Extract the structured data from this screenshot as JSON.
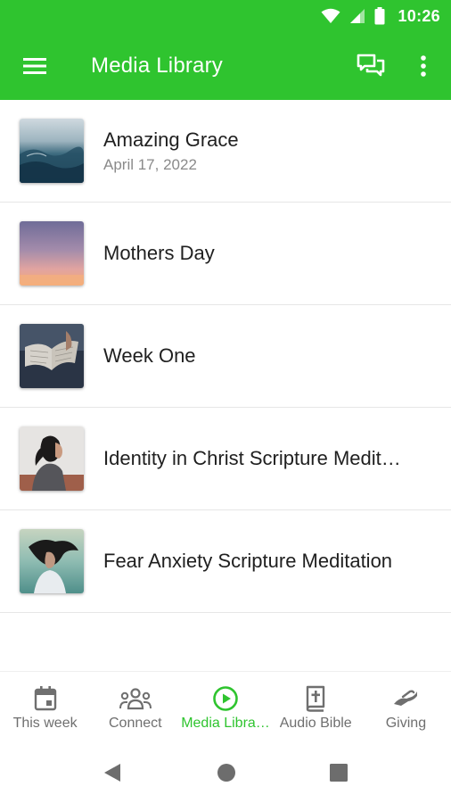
{
  "status_bar": {
    "time": "10:26",
    "icons": [
      "wifi-icon",
      "signal-icon",
      "battery-icon"
    ]
  },
  "app_bar": {
    "title": "Media Library",
    "icons": [
      "menu-icon",
      "chat-icon",
      "more-vert-icon"
    ],
    "color": "#2fc42f"
  },
  "media_list": {
    "items": [
      {
        "title": "Amazing Grace",
        "date": "April 17, 2022",
        "thumbnail": "ocean-waves"
      },
      {
        "title": "Mothers Day",
        "date": "",
        "thumbnail": "sunset-sky"
      },
      {
        "title": "Week One",
        "date": "",
        "thumbnail": "open-book"
      },
      {
        "title": "Identity in Christ Scripture Medit…",
        "date": "",
        "thumbnail": "woman-profile"
      },
      {
        "title": "Fear Anxiety Scripture Meditation",
        "date": "",
        "thumbnail": "woman-hair-wind"
      }
    ]
  },
  "bottom_nav": {
    "tabs": [
      {
        "label": "This week",
        "icon": "calendar-icon",
        "active": false
      },
      {
        "label": "Connect",
        "icon": "group-icon",
        "active": false
      },
      {
        "label": "Media Libra…",
        "icon": "play-circle-icon",
        "active": true
      },
      {
        "label": "Audio Bible",
        "icon": "bible-icon",
        "active": false
      },
      {
        "label": "Giving",
        "icon": "giving-hand-icon",
        "active": false
      }
    ],
    "active_color": "#2fc42f",
    "inactive_color": "#6f6f6f"
  },
  "system_nav": {
    "icons": [
      "back-icon",
      "home-icon",
      "recents-icon"
    ]
  }
}
